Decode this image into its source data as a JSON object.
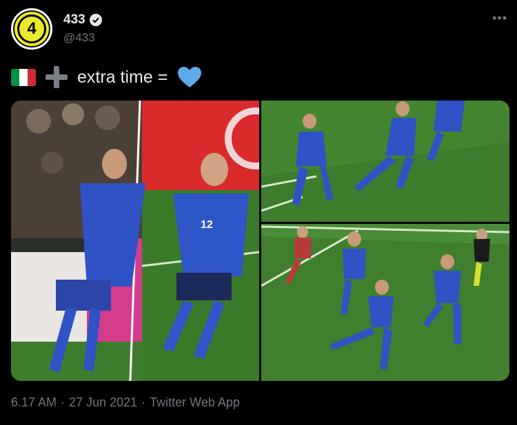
{
  "account": {
    "avatar_text": "4",
    "display_name": "433",
    "handle": "@433"
  },
  "tweet": {
    "text": "extra time =",
    "emoji_icons": [
      "italy-flag-icon",
      "plus-icon",
      "blue-heart-icon"
    ]
  },
  "meta": {
    "time": "6.17 AM",
    "date": "27 Jun 2021",
    "client": "Twitter Web App",
    "separator": "·"
  },
  "colors": {
    "background": "#000000",
    "text": "#e7e9ea",
    "muted": "#71767b",
    "avatar_yellow": "#e9ea2c",
    "heart_blue": "#5da9e9",
    "italy_green": "#009246",
    "italy_white": "#ffffff",
    "italy_red": "#ce2b37"
  }
}
